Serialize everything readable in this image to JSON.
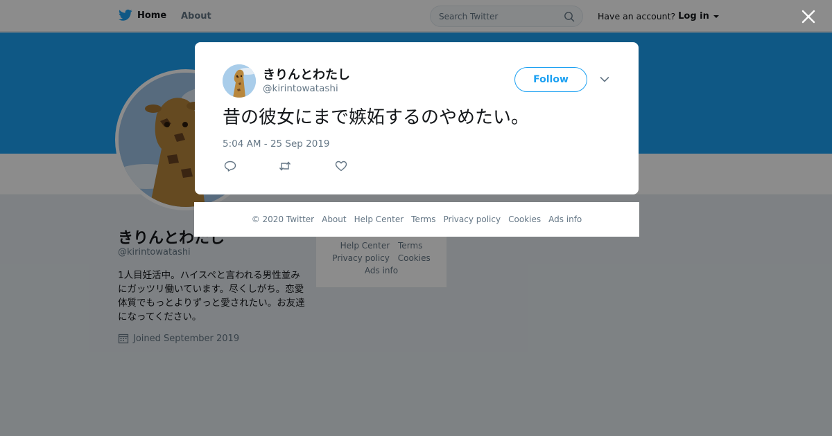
{
  "topbar": {
    "home_label": "Home",
    "about_label": "About",
    "search_placeholder": "Search Twitter",
    "account_prompt": "Have an account?",
    "login_label": "Log in"
  },
  "profile": {
    "name": "きりんとわたし",
    "handle": "@kirintowatashi",
    "bio": "1人目妊活中。ハイスペと言われる男性並みにガッツリ働いています。尽くしがち。恋愛体質でもっとよりずっと愛されたい。お友達になってください。",
    "joined": "Joined September 2019"
  },
  "side_footer": {
    "links": [
      "Help Center",
      "Terms",
      "Privacy policy",
      "Cookies",
      "Ads info"
    ]
  },
  "tweet": {
    "name": "きりんとわたし",
    "handle": "@kirintowatashi",
    "follow_label": "Follow",
    "text": "昔の彼女にまで嫉妬するのやめたい。",
    "timestamp": "5:04 AM - 25 Sep 2019"
  },
  "footer": {
    "links": [
      "© 2020 Twitter",
      "About",
      "Help Center",
      "Terms",
      "Privacy policy",
      "Cookies",
      "Ads info"
    ]
  },
  "colors": {
    "brand": "#1da1f2",
    "secondary_text": "#657786"
  },
  "icons": [
    "twitter-bird-icon",
    "search-icon",
    "close-icon",
    "chevron-down-icon",
    "reply-icon",
    "retweet-icon",
    "like-icon",
    "calendar-icon"
  ]
}
